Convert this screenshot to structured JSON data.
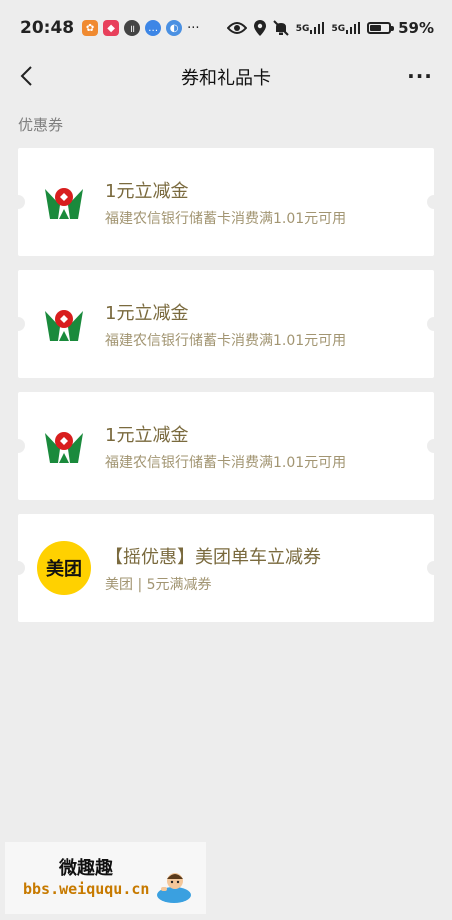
{
  "status_bar": {
    "time": "20:48",
    "network": "5G",
    "battery_percent": "59%",
    "battery_level": 0.59
  },
  "nav": {
    "title": "券和礼品卡",
    "more_label": "···"
  },
  "section_label": "优惠券",
  "coupons": [
    {
      "title": "1元立减金",
      "desc": "福建农信银行储蓄卡消费满1.01元可用",
      "logo": "bank-logo"
    },
    {
      "title": "1元立减金",
      "desc": "福建农信银行储蓄卡消费满1.01元可用",
      "logo": "bank-logo"
    },
    {
      "title": "1元立减金",
      "desc": "福建农信银行储蓄卡消费满1.01元可用",
      "logo": "bank-logo"
    },
    {
      "title": "【摇优惠】美团单车立减券",
      "desc": "美团 | 5元满减券",
      "logo": "meituan-logo",
      "logo_text": "美团"
    }
  ],
  "watermark": {
    "title": "微趣趣",
    "url": "bbs.weiququ.cn"
  },
  "colors": {
    "background": "#ededed",
    "card_title": "#7a6a3e",
    "card_desc": "#a29572",
    "bank_green": "#1a8a3c",
    "bank_red": "#d81e1e",
    "meituan_yellow": "#ffd100"
  }
}
